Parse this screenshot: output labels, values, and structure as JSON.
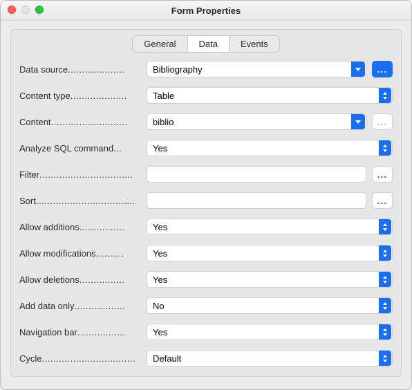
{
  "window": {
    "title": "Form Properties"
  },
  "tabs": {
    "items": [
      "General",
      "Data",
      "Events"
    ],
    "active_index": 1
  },
  "labels": {
    "data_source": "Data source",
    "content_type": "Content type",
    "content": "Content",
    "analyze_sql": "Analyze SQL command",
    "filter": "Filter",
    "sort": "Sort",
    "allow_additions": "Allow additions",
    "allow_modifications": "Allow modifications",
    "allow_deletions": "Allow deletions",
    "add_data_only": "Add data only",
    "navigation_bar": "Navigation bar",
    "cycle": "Cycle"
  },
  "values": {
    "data_source": "Bibliography",
    "content_type": "Table",
    "content": "biblio",
    "analyze_sql": "Yes",
    "filter": "",
    "sort": "",
    "allow_additions": "Yes",
    "allow_modifications": "Yes",
    "allow_deletions": "Yes",
    "add_data_only": "No",
    "navigation_bar": "Yes",
    "cycle": "Default"
  },
  "buttons": {
    "ellipsis": "..."
  }
}
